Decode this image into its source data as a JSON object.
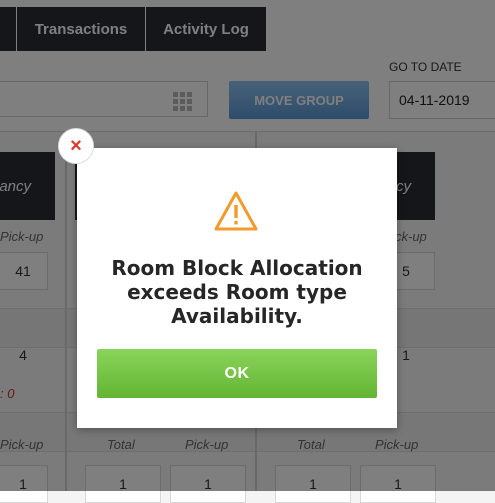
{
  "tabs": [
    {
      "label": ""
    },
    {
      "label": "Transactions"
    },
    {
      "label": "Activity Log"
    }
  ],
  "toolbar": {
    "move_group_label": "MOVE GROUP",
    "goto_date_label": "GO TO DATE",
    "goto_date_value": "04-11-2019"
  },
  "grid": {
    "col_a": {
      "header_fragment": "ancy",
      "pickup_label": "Pick-up",
      "pickup_value": "41",
      "row2_value": "4",
      "red_note": ": 0",
      "pickup_label_2": "Pick-up",
      "pickup_value_2": "1"
    },
    "col_b": {
      "total_label": "Total",
      "pickup_label": "Pick-up",
      "total_value": "1",
      "pickup_value": "1"
    },
    "col_c": {
      "header_fragment": "cy",
      "pickup_label": "ck-up",
      "pickup_value": "5",
      "row2_value": "1",
      "total_label": "Total",
      "pickup_label_2": "Pick-up",
      "total_value": "1",
      "pickup_value_2": "1"
    }
  },
  "dialog": {
    "message": "Room Block Allocation exceeds Room type Availability.",
    "ok_label": "OK",
    "close_glyph": "×"
  },
  "colors": {
    "accent_green": "#6cbf3c",
    "warning_orange": "#f39a2b",
    "close_red": "#e0352b",
    "button_blue": "#6aa7e0",
    "tab_dark": "#2b2d33"
  },
  "icons": {
    "close": "close-icon",
    "warning": "warning-icon",
    "grid": "grid-icon"
  }
}
